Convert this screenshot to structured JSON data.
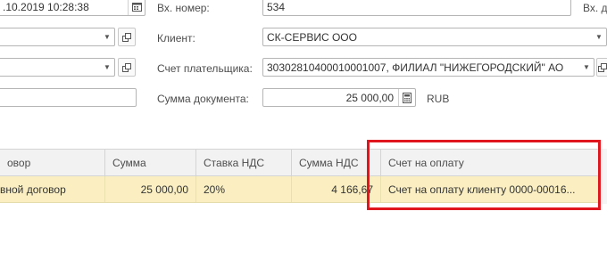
{
  "form": {
    "date_value": ".10.2019 10:28:38",
    "inc_number_label": "Вх. номер:",
    "inc_number_value": "534",
    "inc_date_label_partial": "Вх. д",
    "client_label": "Клиент:",
    "client_value": "СК-СЕРВИС ООО",
    "payer_account_label": "Счет плательщика:",
    "payer_account_value": "30302810400010001007, ФИЛИАЛ \"НИЖЕГОРОДСКИЙ\" АО",
    "doc_sum_label": "Сумма документа:",
    "doc_sum_value": "25 000,00",
    "currency": "RUB"
  },
  "table": {
    "columns": [
      "овор",
      "Сумма",
      "Ставка НДС",
      "Сумма НДС",
      "Счет на оплату"
    ],
    "rows": [
      [
        "вной договор",
        "25 000,00",
        "20%",
        "4 166,67",
        "Счет на оплату клиенту 0000-00016..."
      ]
    ]
  },
  "icons": {
    "dropdown": "chevron-down-icon",
    "open": "open-form-icon",
    "calendar": "calendar-icon",
    "calculator": "calculator-icon"
  },
  "colors": {
    "selected_row": "#fbefc2",
    "highlight_border": "#e0161e"
  }
}
